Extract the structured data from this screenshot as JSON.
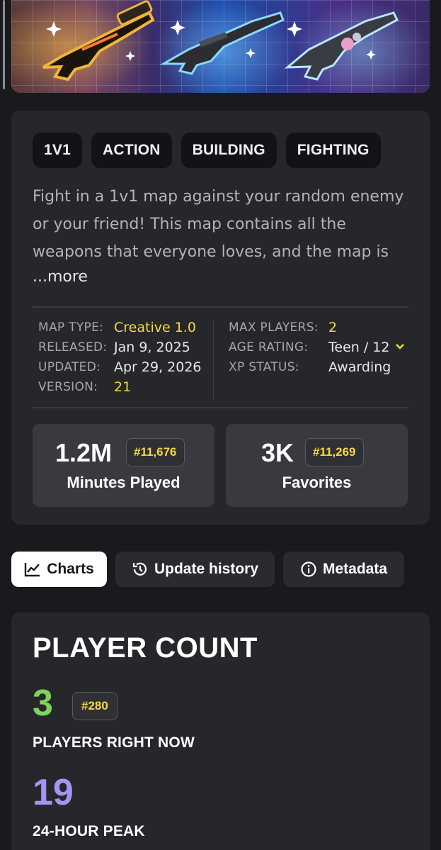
{
  "hero": {
    "icon": "weapons-banner-image",
    "colors": {
      "left_glow": "#ffbe46",
      "mid_glow": "#78c8ff",
      "right_glow": "#8cdcff"
    }
  },
  "tags": [
    "1V1",
    "ACTION",
    "BUILDING",
    "FIGHTING"
  ],
  "description": {
    "line1": "Fight in a 1v1 map against your random enemy",
    "line2": "or your friend! This map contains all the",
    "line3": "weapons that everyone loves, and the map is",
    "more": "...more"
  },
  "meta_left": [
    {
      "key": "MAP TYPE:",
      "value": "Creative 1.0",
      "highlight": true
    },
    {
      "key": "RELEASED:",
      "value": "Jan 9, 2025",
      "highlight": false
    },
    {
      "key": "UPDATED:",
      "value": "Apr 29, 2026",
      "highlight": false
    },
    {
      "key": "VERSION:",
      "value": "21",
      "highlight": true
    }
  ],
  "meta_right": [
    {
      "key": "MAX PLAYERS:",
      "value": "2",
      "highlight": true
    },
    {
      "key": "AGE RATING:",
      "value": "Teen / 12",
      "highlight": false
    },
    {
      "key": "XP STATUS:",
      "value": "Awarding",
      "highlight": false
    }
  ],
  "stats": [
    {
      "value": "1.2M",
      "rank": "#11,676",
      "label": "Minutes Played"
    },
    {
      "value": "3K",
      "rank": "#11,269",
      "label": "Favorites"
    }
  ],
  "tabs": [
    {
      "label": "Charts",
      "icon": "line-chart-icon",
      "active": true
    },
    {
      "label": "Update history",
      "icon": "history-clock-icon",
      "active": false
    },
    {
      "label": "Metadata",
      "icon": "info-circle-icon",
      "active": false
    }
  ],
  "player_count": {
    "title": "PLAYER COUNT",
    "now_value": "3",
    "now_rank": "#280",
    "now_label": "PLAYERS RIGHT NOW",
    "peak_value": "19",
    "peak_label": "24-HOUR PEAK"
  },
  "colors": {
    "accent_yellow": "#f5d842",
    "green": "#7fd35a",
    "purple": "#a594f0",
    "card_bg": "#26272b",
    "page_bg": "#191a1e"
  }
}
